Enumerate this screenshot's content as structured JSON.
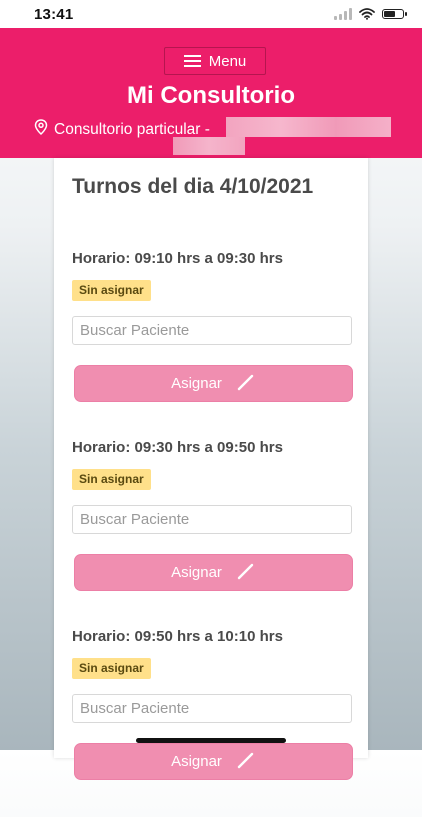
{
  "status_bar": {
    "time": "13:41"
  },
  "header": {
    "menu_label": "Menu",
    "title": "Mi Consultorio",
    "location_text": "Consultorio particular -"
  },
  "main": {
    "title": "Turnos del dia 4/10/2021",
    "slots": [
      {
        "time": "Horario: 09:10 hrs a 09:30 hrs",
        "badge": "Sin asignar",
        "search_placeholder": "Buscar Paciente",
        "button_label": "Asignar"
      },
      {
        "time": "Horario: 09:30 hrs a 09:50 hrs",
        "badge": "Sin asignar",
        "search_placeholder": "Buscar Paciente",
        "button_label": "Asignar"
      },
      {
        "time": "Horario: 09:50 hrs a 10:10 hrs",
        "badge": "Sin asignar",
        "search_placeholder": "Buscar Paciente",
        "button_label": "Asignar"
      }
    ]
  },
  "colors": {
    "header": "#ec1e6a",
    "button": "#f08eb0",
    "badge": "#ffe08a",
    "text": "#4a4a4a"
  },
  "icons": [
    "hamburger-icon",
    "location-pin-icon",
    "pencil-icon",
    "signal-icon",
    "wifi-icon",
    "battery-icon"
  ]
}
